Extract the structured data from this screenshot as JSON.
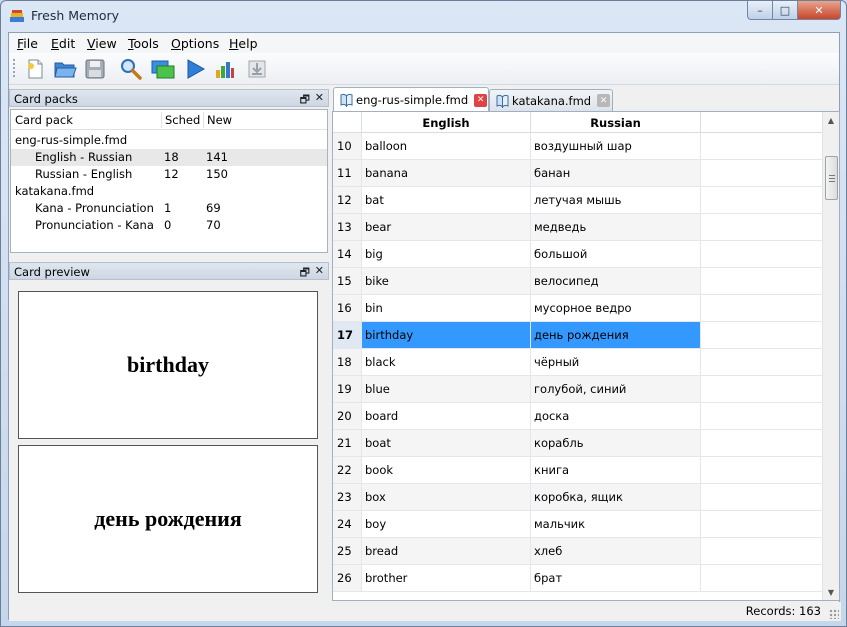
{
  "window": {
    "title": "Fresh Memory",
    "controls": {
      "minimize": "–",
      "maximize": "□",
      "close": "✕"
    }
  },
  "menu": [
    {
      "underline": "F",
      "rest": "ile"
    },
    {
      "underline": "E",
      "rest": "dit"
    },
    {
      "underline": "V",
      "rest": "iew"
    },
    {
      "underline": "T",
      "rest": "ools"
    },
    {
      "underline": "O",
      "rest": "ptions"
    },
    {
      "underline": "H",
      "rest": "elp"
    }
  ],
  "toolbar": {
    "icons": [
      "new-file-icon",
      "open-folder-icon",
      "save-icon",
      "search-icon",
      "study-window-icon",
      "play-icon",
      "statistics-icon",
      "import-icon"
    ]
  },
  "card_packs": {
    "title": "Card packs",
    "float": "🗗",
    "close": "✕",
    "headers": {
      "pack": "Card pack",
      "sched": "Sched",
      "new": "New"
    },
    "rows": [
      {
        "name": "eng-rus-simple.fmd",
        "sched": "",
        "new": "",
        "level": 0
      },
      {
        "name": "English - Russian",
        "sched": "18",
        "new": "141",
        "level": 1
      },
      {
        "name": "Russian - English",
        "sched": "12",
        "new": "150",
        "level": 1
      },
      {
        "name": "katakana.fmd",
        "sched": "",
        "new": "",
        "level": 0
      },
      {
        "name": "Kana - Pronunciation",
        "sched": "1",
        "new": "69",
        "level": 1
      },
      {
        "name": "Pronunciation - Kana",
        "sched": "0",
        "new": "70",
        "level": 1
      }
    ]
  },
  "card_preview": {
    "title": "Card preview",
    "float": "🗗",
    "close": "✕",
    "question": "birthday",
    "answer": "день рождения"
  },
  "tabs": [
    {
      "label": "eng-rus-simple.fmd",
      "active": true
    },
    {
      "label": "katakana.fmd",
      "active": false
    }
  ],
  "grid": {
    "headers": {
      "english": "English",
      "russian": "Russian"
    },
    "rows": [
      {
        "n": "10",
        "en": "balloon",
        "ru": "воздушный шар"
      },
      {
        "n": "11",
        "en": "banana",
        "ru": "банан"
      },
      {
        "n": "12",
        "en": "bat",
        "ru": "летучая мышь"
      },
      {
        "n": "13",
        "en": "bear",
        "ru": "медведь"
      },
      {
        "n": "14",
        "en": "big",
        "ru": "большой"
      },
      {
        "n": "15",
        "en": "bike",
        "ru": "велосипед"
      },
      {
        "n": "16",
        "en": "bin",
        "ru": "мусорное ведро"
      },
      {
        "n": "17",
        "en": "birthday",
        "ru": "день рождения",
        "selected": true
      },
      {
        "n": "18",
        "en": "black",
        "ru": "чёрный"
      },
      {
        "n": "19",
        "en": "blue",
        "ru": "голубой, синий"
      },
      {
        "n": "20",
        "en": "board",
        "ru": "доска"
      },
      {
        "n": "21",
        "en": "boat",
        "ru": "корабль"
      },
      {
        "n": "22",
        "en": "book",
        "ru": "книга"
      },
      {
        "n": "23",
        "en": "box",
        "ru": "коробка, ящик"
      },
      {
        "n": "24",
        "en": "boy",
        "ru": "мальчик"
      },
      {
        "n": "25",
        "en": "bread",
        "ru": "хлеб"
      },
      {
        "n": "26",
        "en": "brother",
        "ru": "брат"
      }
    ]
  },
  "status": {
    "records": "Records: 163"
  },
  "colors": {
    "selection": "#3399ff",
    "tab_close_active": "#e04343",
    "tab_close_inactive": "#b8b8b8"
  }
}
